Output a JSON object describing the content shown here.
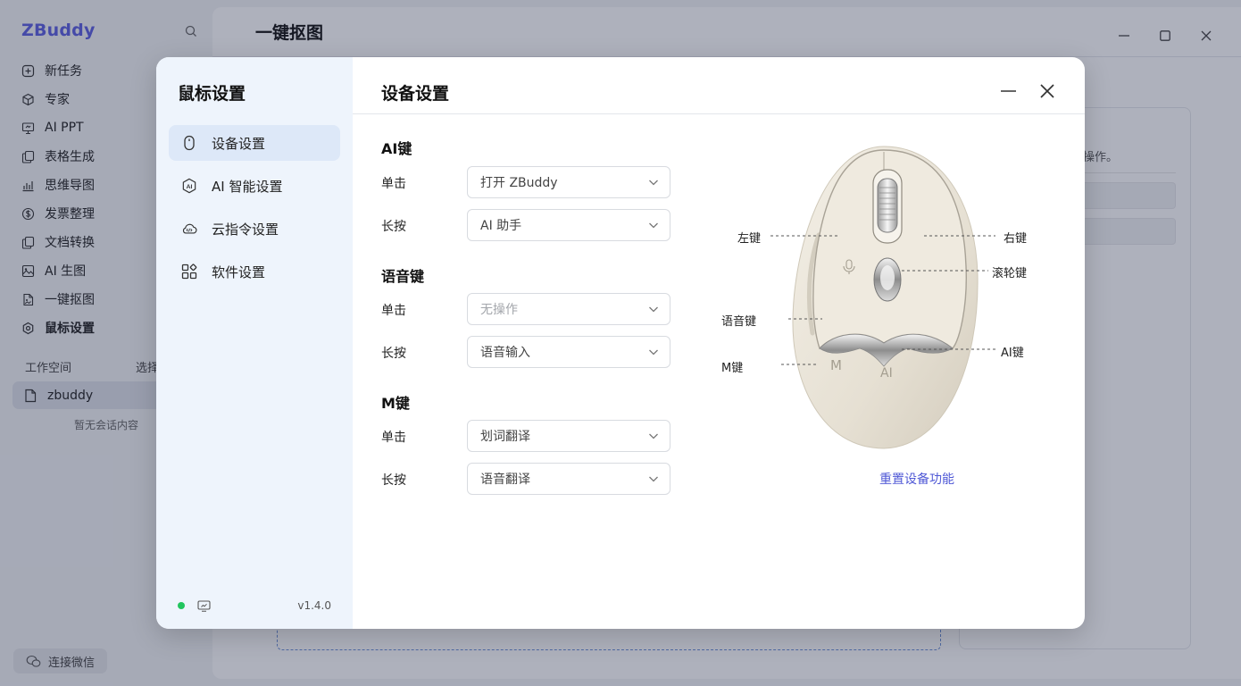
{
  "app": {
    "brand": "ZBuddy",
    "nav": [
      {
        "label": "新任务",
        "icon": "plus-square-icon"
      },
      {
        "label": "专家",
        "icon": "cube-icon"
      },
      {
        "label": "AI PPT",
        "icon": "presentation-icon"
      },
      {
        "label": "表格生成",
        "icon": "copy-icon"
      },
      {
        "label": "思维导图",
        "icon": "chart-icon"
      },
      {
        "label": "发票整理",
        "icon": "dollar-icon"
      },
      {
        "label": "文档转换",
        "icon": "copy-icon"
      },
      {
        "label": "AI 生图",
        "icon": "image-icon"
      },
      {
        "label": "一键抠图",
        "icon": "file-image-icon"
      },
      {
        "label": "鼠标设置",
        "icon": "hexagon-icon"
      }
    ],
    "active_nav": "鼠标设置",
    "workspace_label": "工作空间",
    "workspace_select": "选择",
    "workspace_name": "zbuddy",
    "workspace_empty": "暂无会话内容",
    "wechat_label": "连接微信",
    "page_title": "一键抠图",
    "panel_hint": "操作。"
  },
  "modal": {
    "side_title": "鼠标设置",
    "menu": [
      {
        "label": "设备设置",
        "icon": "mouse-icon",
        "active": true
      },
      {
        "label": "AI 智能设置",
        "icon": "ai-badge-icon",
        "active": false
      },
      {
        "label": "云指令设置",
        "icon": "cloud-code-icon",
        "active": false
      },
      {
        "label": "软件设置",
        "icon": "grid-icon",
        "active": false
      }
    ],
    "version": "v1.4.0",
    "title": "设备设置",
    "sections": [
      {
        "title": "AI键",
        "rows": [
          {
            "label": "单击",
            "value": "打开 ZBuddy",
            "muted": false
          },
          {
            "label": "长按",
            "value": "AI 助手",
            "muted": false
          }
        ]
      },
      {
        "title": "语音键",
        "rows": [
          {
            "label": "单击",
            "value": "无操作",
            "muted": true
          },
          {
            "label": "长按",
            "value": "语音输入",
            "muted": false
          }
        ]
      },
      {
        "title": "M键",
        "rows": [
          {
            "label": "单击",
            "value": "划词翻译",
            "muted": false
          },
          {
            "label": "长按",
            "value": "语音翻译",
            "muted": false
          }
        ]
      }
    ],
    "callouts": {
      "left": "左键",
      "right": "右键",
      "wheel": "滚轮键",
      "voice": "语音键",
      "ai": "AI键",
      "m": "M键"
    },
    "mouse_marks": {
      "m": "M",
      "ai": "AI"
    },
    "reset_label": "重置设备功能"
  },
  "colors": {
    "brand": "#5b5fe0",
    "link": "#4f58d6",
    "status_online": "#22c55e",
    "menu_active": "#dde8f8"
  }
}
